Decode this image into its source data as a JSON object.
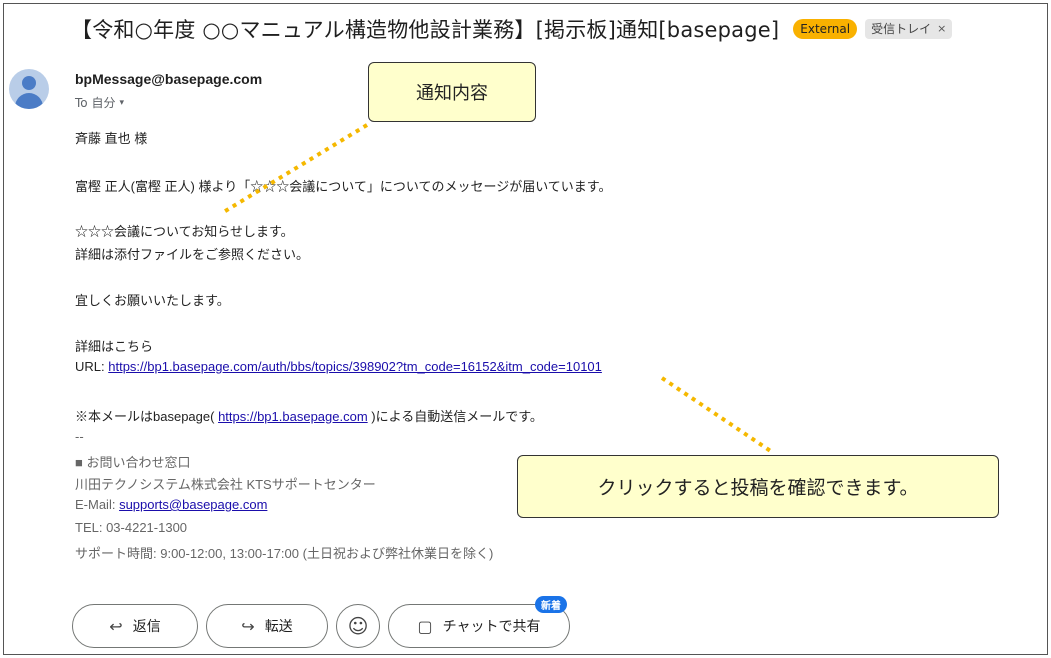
{
  "subject": {
    "title": "【令和○年度 ○○マニュアル構造物他設計業務】[掲示板]通知[basepage]",
    "label_external": "External",
    "label_inbox": "受信トレイ",
    "label_inbox_close": "×"
  },
  "sender": {
    "email": "bpMessage@basepage.com",
    "to": "To 自分",
    "caret": "▾",
    "avatar_icon": "person-icon"
  },
  "body": {
    "greeting": "斉藤 直也 様",
    "intro": "富樫 正人(富樫 正人) 様より「☆☆☆会議について」についてのメッセージが届いています。",
    "message_line1": "☆☆☆会議についてお知らせします。",
    "message_line2": "詳細は添付ファイルをご参照ください。",
    "closing": "宜しくお願いいたします。",
    "details_heading": "詳細はこちら",
    "url_label": "URL: ",
    "url": "https://bp1.basepage.com/auth/bbs/topics/398902?tm_code=16152&itm_code=10101",
    "auto_prefix": "※本メールはbasepage( ",
    "auto_link": "https://bp1.basepage.com",
    "auto_suffix": " )による自動送信メールです。",
    "separator": "--",
    "contact_heading": "■ お問い合わせ窓口",
    "company": "川田テクノシステム株式会社 KTSサポートセンター",
    "email_label": "E-Mail: ",
    "support_email": "supports@basepage.com",
    "tel": "TEL: 03-4221-1300",
    "hours": "サポート時間: 9:00-12:00, 13:00-17:00 (土日祝および弊社休業日を除く)"
  },
  "callouts": {
    "content": "通知内容",
    "click_hint": "クリックすると投稿を確認できます。"
  },
  "actions": {
    "reply_icon": "reply-icon",
    "reply_glyph": "↩",
    "reply": "返信",
    "forward_icon": "forward-icon",
    "forward_glyph": "↪",
    "forward": "転送",
    "emoji_icon": "smiley-icon",
    "emoji_glyph": "☺",
    "chat_icon": "chat-bubble-icon",
    "chat_glyph": "▢",
    "chat": "チャットで共有",
    "new_badge": "新着"
  },
  "colors": {
    "external_label": "#f9b100",
    "callout_bg": "#ffffcc",
    "dotted_leader": "#f5b800",
    "link": "#1a0dab",
    "badge": "#1a73e8"
  }
}
